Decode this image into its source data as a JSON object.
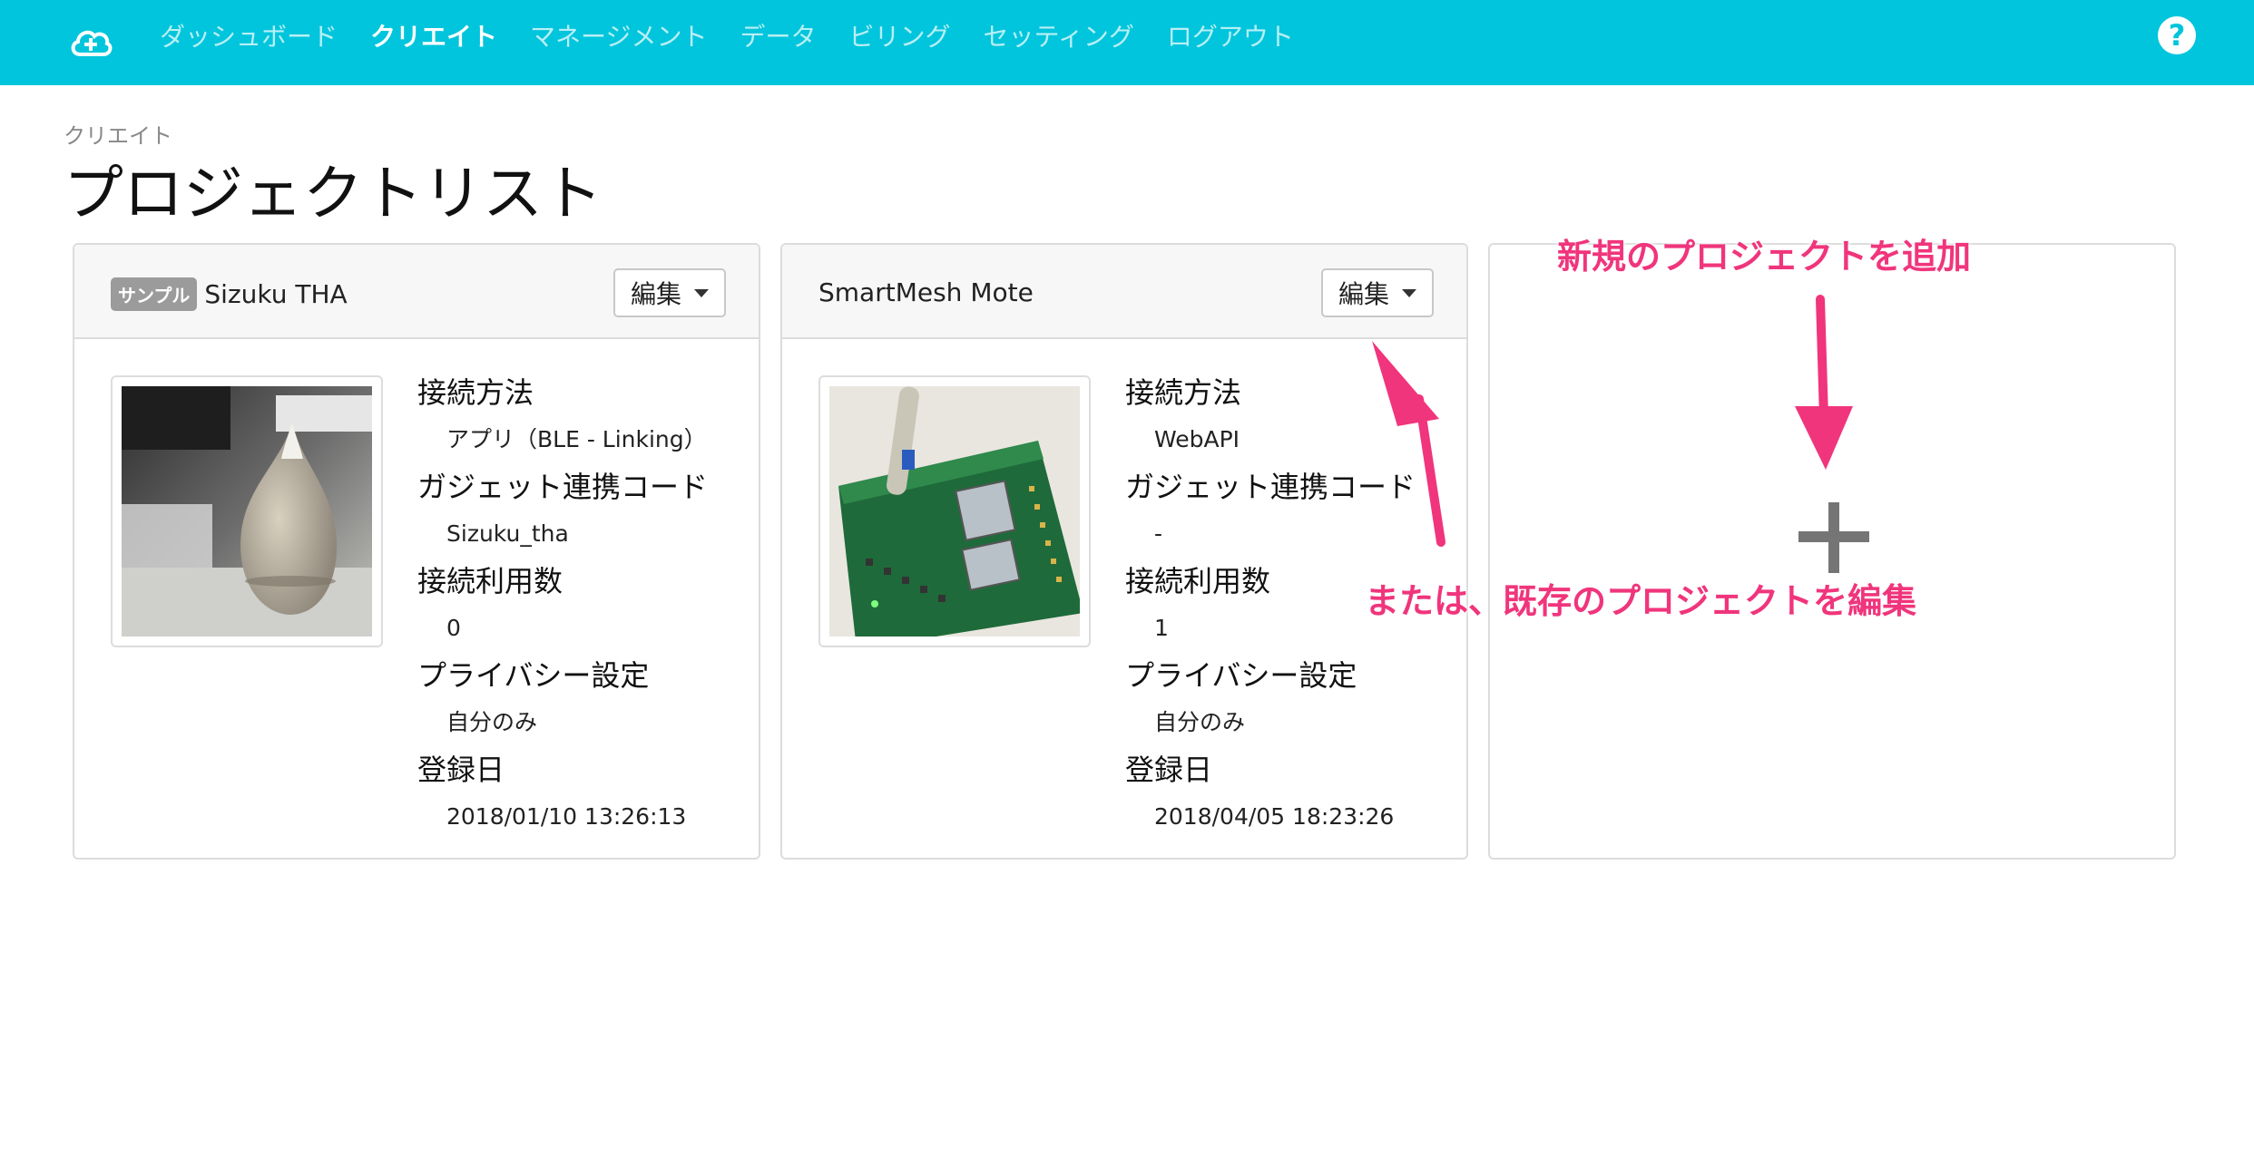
{
  "nav": {
    "logo_icon": "cloud-plus-icon",
    "items": [
      {
        "label": "ダッシュボード"
      },
      {
        "label": "クリエイト",
        "active": true
      },
      {
        "label": "マネージメント"
      },
      {
        "label": "データ"
      },
      {
        "label": "ビリング"
      },
      {
        "label": "セッティング"
      },
      {
        "label": "ログアウト"
      }
    ],
    "help_label": "?"
  },
  "breadcrumb": "クリエイト",
  "page_title": "プロジェクトリスト",
  "projects": [
    {
      "badge": "サンプル",
      "title": "Sizuku THA",
      "edit_label": "編集",
      "fields": [
        {
          "label": "接続方法",
          "value": "アプリ（BLE - Linking）"
        },
        {
          "label": "ガジェット連携コード",
          "value": "Sizuku_tha"
        },
        {
          "label": "接続利用数",
          "value": "0"
        },
        {
          "label": "プライバシー設定",
          "value": "自分のみ"
        },
        {
          "label": "登録日",
          "value": "2018/01/10 13:26:13"
        }
      ]
    },
    {
      "title": "SmartMesh Mote",
      "edit_label": "編集",
      "fields": [
        {
          "label": "接続方法",
          "value": "WebAPI"
        },
        {
          "label": "ガジェット連携コード",
          "value": "-"
        },
        {
          "label": "接続利用数",
          "value": "1"
        },
        {
          "label": "プライバシー設定",
          "value": "自分のみ"
        },
        {
          "label": "登録日",
          "value": "2018/04/05 18:23:26"
        }
      ]
    }
  ],
  "add_card": {
    "icon": "plus-icon"
  },
  "annotations": {
    "add_new": "新規のプロジェクトを追加",
    "or_edit": "または、既存のプロジェクトを編集"
  },
  "colors": {
    "navbar": "#00c5dc",
    "annotation": "#f0357c"
  }
}
